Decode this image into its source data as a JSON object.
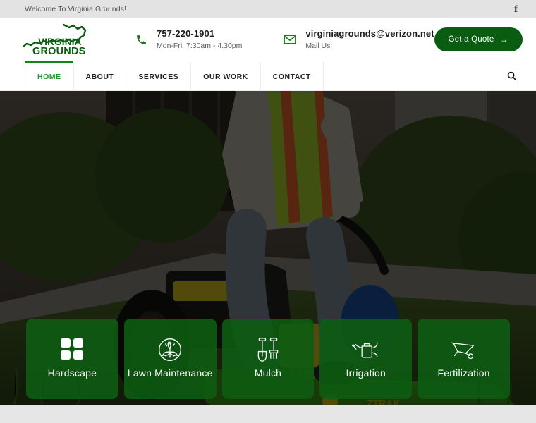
{
  "topbar": {
    "welcome": "Welcome To Virginia Grounds!",
    "social": [
      {
        "name": "facebook-icon",
        "glyph": "f"
      }
    ]
  },
  "brand": {
    "name_line1": "VIRGINIA",
    "name_line2": "GROUNDS",
    "logo_icon": "virginia-state-outline-icon",
    "color": "#0a5c10"
  },
  "header": {
    "phone": {
      "icon": "phone-icon",
      "value": "757-220-1901",
      "sub": "Mon-Fri, 7:30am - 4.30pm"
    },
    "email": {
      "icon": "envelope-icon",
      "value": "virginiagrounds@verizon.net",
      "sub": "Mail Us"
    },
    "quote_button": {
      "label": "Get a Quote",
      "arrow": "→",
      "color": "#0a5c10"
    }
  },
  "nav": {
    "items": [
      {
        "label": "HOME",
        "active": true
      },
      {
        "label": "ABOUT",
        "active": false
      },
      {
        "label": "SERVICES",
        "active": false
      },
      {
        "label": "OUR WORK",
        "active": false
      },
      {
        "label": "CONTACT",
        "active": false
      }
    ],
    "search_icon": "search-icon",
    "active_color": "#1a9c22"
  },
  "hero": {
    "image_description": "Landscaper operating a green John Deere ZTrak zero-turn riding lawn mower on a lawn",
    "overlay": "dark"
  },
  "services": {
    "cards": [
      {
        "label": "Hardscape",
        "icon": "grid-squares-icon"
      },
      {
        "label": "Lawn Maintenance",
        "icon": "plant-in-circle-icon"
      },
      {
        "label": "Mulch",
        "icon": "shovel-and-fork-icon"
      },
      {
        "label": "Irrigation",
        "icon": "watering-can-icon"
      },
      {
        "label": "Fertilization",
        "icon": "wheelbarrow-icon"
      }
    ],
    "card_color": "#0d5c12"
  }
}
